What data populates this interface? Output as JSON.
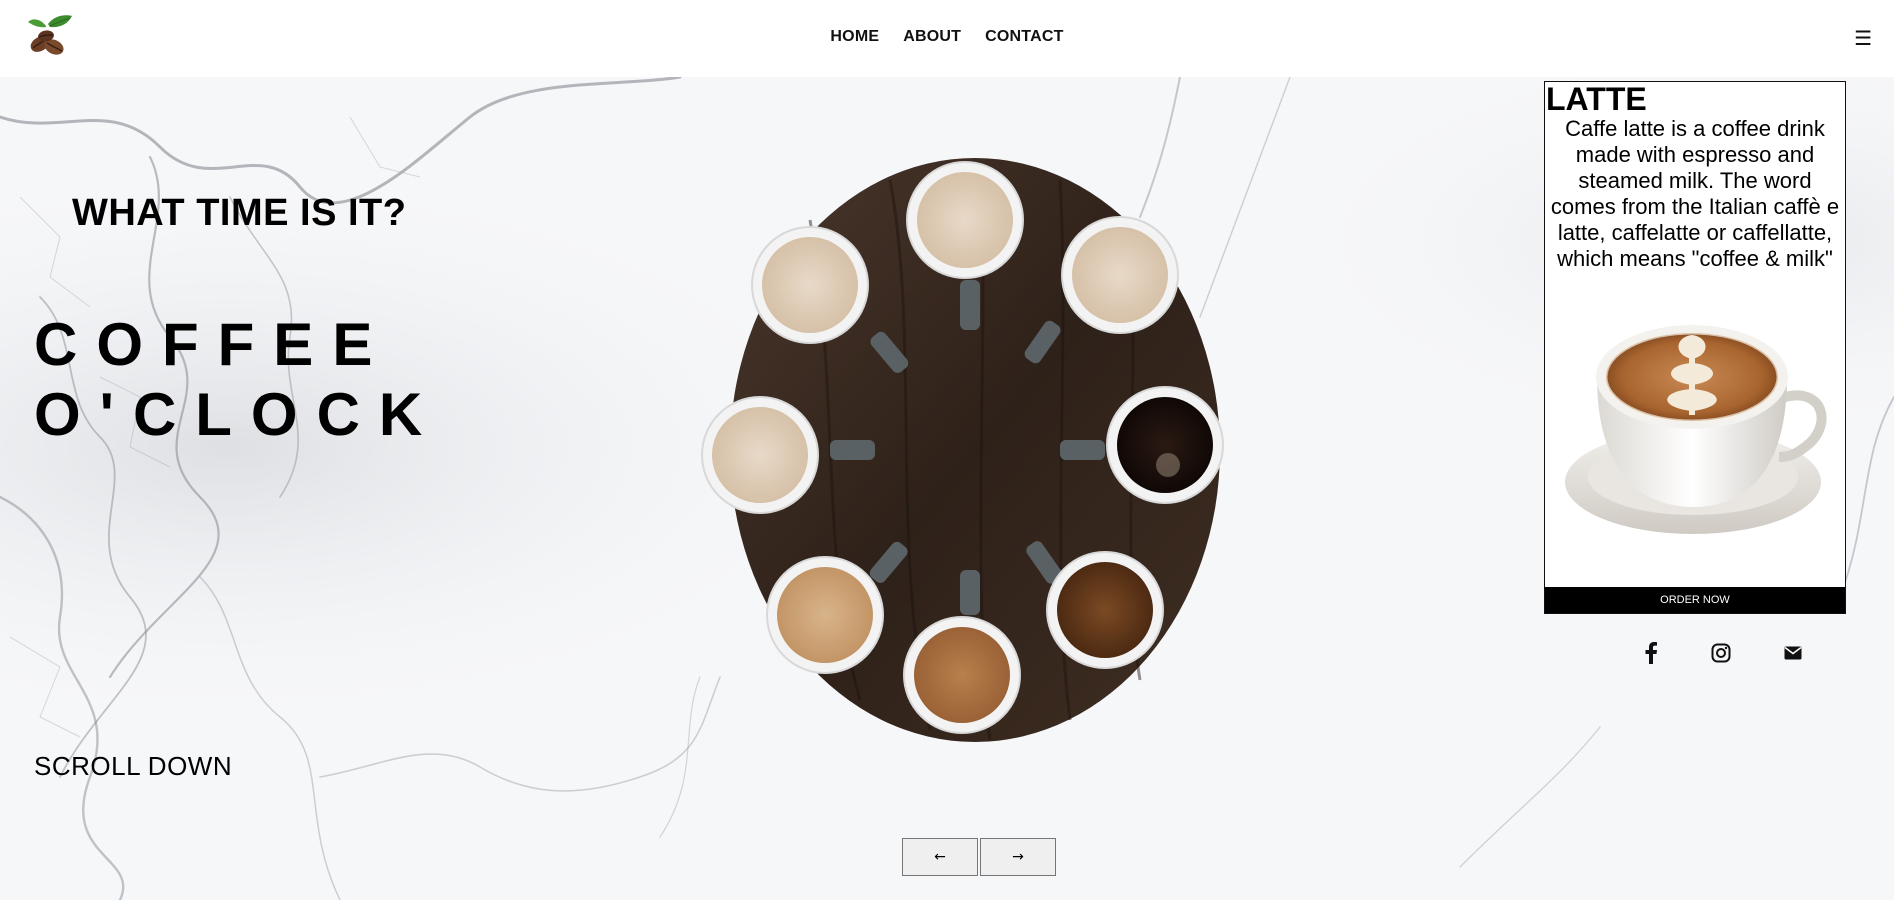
{
  "nav": {
    "items": [
      {
        "label": "HOME"
      },
      {
        "label": "ABOUT"
      },
      {
        "label": "CONTACT"
      }
    ],
    "menu_icon": "☰"
  },
  "hero": {
    "question": "WHAT TIME IS IT?",
    "headline_line1": "COFFEE",
    "headline_line2": "O'CLOCK",
    "scroll_label": "SCROLL DOWN"
  },
  "card": {
    "title": "LATTE",
    "description": "Caffe latte is a coffee drink made with espresso and steamed milk. The word comes from the Italian caffè e latte, caffelatte or caffellatte, which means \"coffee & milk\"",
    "order_label": "ORDER NOW"
  },
  "social": {
    "icons": [
      "facebook-icon",
      "instagram-icon",
      "mail-icon"
    ]
  },
  "pager": {
    "prev_label": "←",
    "next_label": "→"
  },
  "colors": {
    "header_bg": "#ffffff",
    "page_bg": "#f6f7f9",
    "button_dark": "#000000",
    "wood": "#3b2a20"
  }
}
